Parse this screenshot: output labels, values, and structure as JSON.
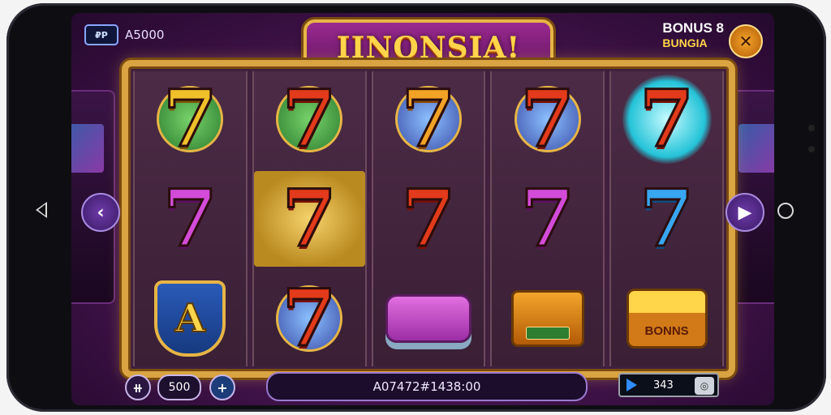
{
  "wallet": {
    "icon_text": "₽P",
    "balance": "A5000"
  },
  "title": "IINONSIA!",
  "bonus": {
    "line1": "BONUS 8",
    "line2": "BUNGIA"
  },
  "settings_icon": "crossed-tools-icon",
  "reels": [
    [
      {
        "type": "seven",
        "color": "gold",
        "label": "7",
        "style": "badge"
      },
      {
        "type": "seven",
        "color": "purple",
        "label": "7"
      },
      {
        "type": "shield",
        "label": "A"
      }
    ],
    [
      {
        "type": "seven",
        "color": "red",
        "label": "7",
        "style": "badge-green"
      },
      {
        "type": "seven",
        "color": "red",
        "label": "7",
        "highlight": true
      },
      {
        "type": "seven",
        "color": "red",
        "label": "7",
        "style": "badge-blue"
      }
    ],
    [
      {
        "type": "seven",
        "color": "orange",
        "label": "7",
        "style": "badge-blue"
      },
      {
        "type": "seven",
        "color": "red",
        "label": "7"
      },
      {
        "type": "pillow"
      }
    ],
    [
      {
        "type": "seven",
        "color": "red",
        "label": "7",
        "style": "badge-blue"
      },
      {
        "type": "seven",
        "color": "purple",
        "label": "7"
      },
      {
        "type": "basket"
      }
    ],
    [
      {
        "type": "seven",
        "color": "red",
        "label": "7",
        "style": "glow"
      },
      {
        "type": "seven",
        "color": "blue",
        "label": "7"
      },
      {
        "type": "chest",
        "label": "BONNS"
      }
    ]
  ],
  "controls": {
    "prev_icon": "chevron-left-icon",
    "next_icon": "play-right-icon",
    "settings_glyph": "⧺",
    "bet_value": "500",
    "plus_label": "+",
    "win_text": "A07472#1438:00",
    "spin_count": "343"
  }
}
